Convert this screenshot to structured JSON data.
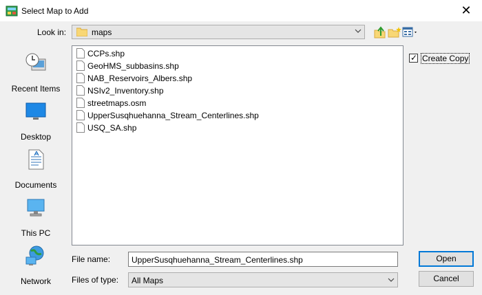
{
  "window": {
    "title": "Select Map to Add"
  },
  "lookin": {
    "label": "Look in:",
    "value": "maps"
  },
  "places": [
    {
      "label": "Recent Items",
      "icon": "recent-items-icon"
    },
    {
      "label": "Desktop",
      "icon": "desktop-icon"
    },
    {
      "label": "Documents",
      "icon": "documents-icon"
    },
    {
      "label": "This PC",
      "icon": "this-pc-icon"
    },
    {
      "label": "Network",
      "icon": "network-icon"
    }
  ],
  "files": [
    "CCPs.shp",
    "GeoHMS_subbasins.shp",
    "NAB_Reservoirs_Albers.shp",
    "NSIv2_Inventory.shp",
    "streetmaps.osm",
    "UpperSusqhuehanna_Stream_Centerlines.shp",
    "USQ_SA.shp"
  ],
  "create_copy": {
    "label": "Create Copy",
    "checked": true
  },
  "filename": {
    "label": "File name:",
    "value": "UpperSusqhuehanna_Stream_Centerlines.shp"
  },
  "filetype": {
    "label": "Files of type:",
    "value": "All Maps"
  },
  "buttons": {
    "open": "Open",
    "cancel": "Cancel"
  },
  "colors": {
    "accent": "#0078d7",
    "folder": "#f8d775"
  }
}
